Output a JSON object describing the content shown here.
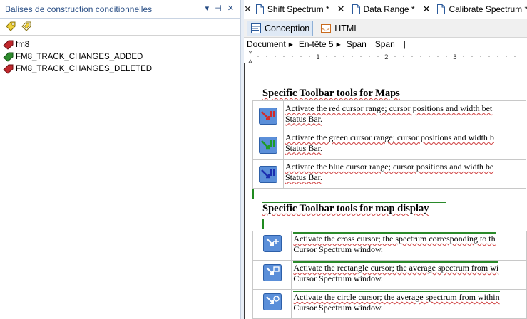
{
  "left_panel": {
    "title": "Balises de construction conditionnelles",
    "controls": [
      "▾",
      "⊣",
      "✕"
    ],
    "tags": [
      {
        "label": "fm8",
        "color": "#c0282d"
      },
      {
        "label": "FM8_TRACK_CHANGES_ADDED",
        "color": "#2e8b2e"
      },
      {
        "label": "FM8_TRACK_CHANGES_DELETED",
        "color": "#c0282d"
      }
    ]
  },
  "tabs": [
    {
      "label": "Shift Spectrum *"
    },
    {
      "label": "Data Range *"
    },
    {
      "label": "Calibrate Spectrum *"
    }
  ],
  "views": {
    "conception": "Conception",
    "html": "HTML"
  },
  "breadcrumb": {
    "document": "Document",
    "heading": "En-tête 5",
    "span1": "Span",
    "span2": "Span",
    "cursor": "|"
  },
  "ruler": {
    "marks": [
      "1",
      "2",
      "3"
    ]
  },
  "section1": {
    "title": "Specific Toolbar tools for Maps",
    "rows": [
      {
        "line1": "Activate the red cursor range; cursor positions and width bet",
        "line2": "Status Bar.",
        "icon_color": "#d12b2b"
      },
      {
        "line1": "Activate the green cursor range; cursor positions and width b",
        "line2": "Status Bar.",
        "icon_color": "#1e9a2a"
      },
      {
        "line1": "Activate the blue cursor range; cursor positions and width be",
        "line2": "Status Bar.",
        "icon_color": "#2a4fd0"
      }
    ]
  },
  "section2": {
    "title": "Specific Toolbar tools for map display",
    "rows": [
      {
        "line1": "Activate the cross cursor; the spectrum corresponding to th",
        "line2": "Cursor Spectrum window."
      },
      {
        "line1": "Activate the rectangle cursor; the average spectrum from wi",
        "line2": "Cursor Spectrum window."
      },
      {
        "line1": "Activate the circle cursor; the average spectrum from within",
        "line2": "Cursor Spectrum window."
      }
    ]
  }
}
